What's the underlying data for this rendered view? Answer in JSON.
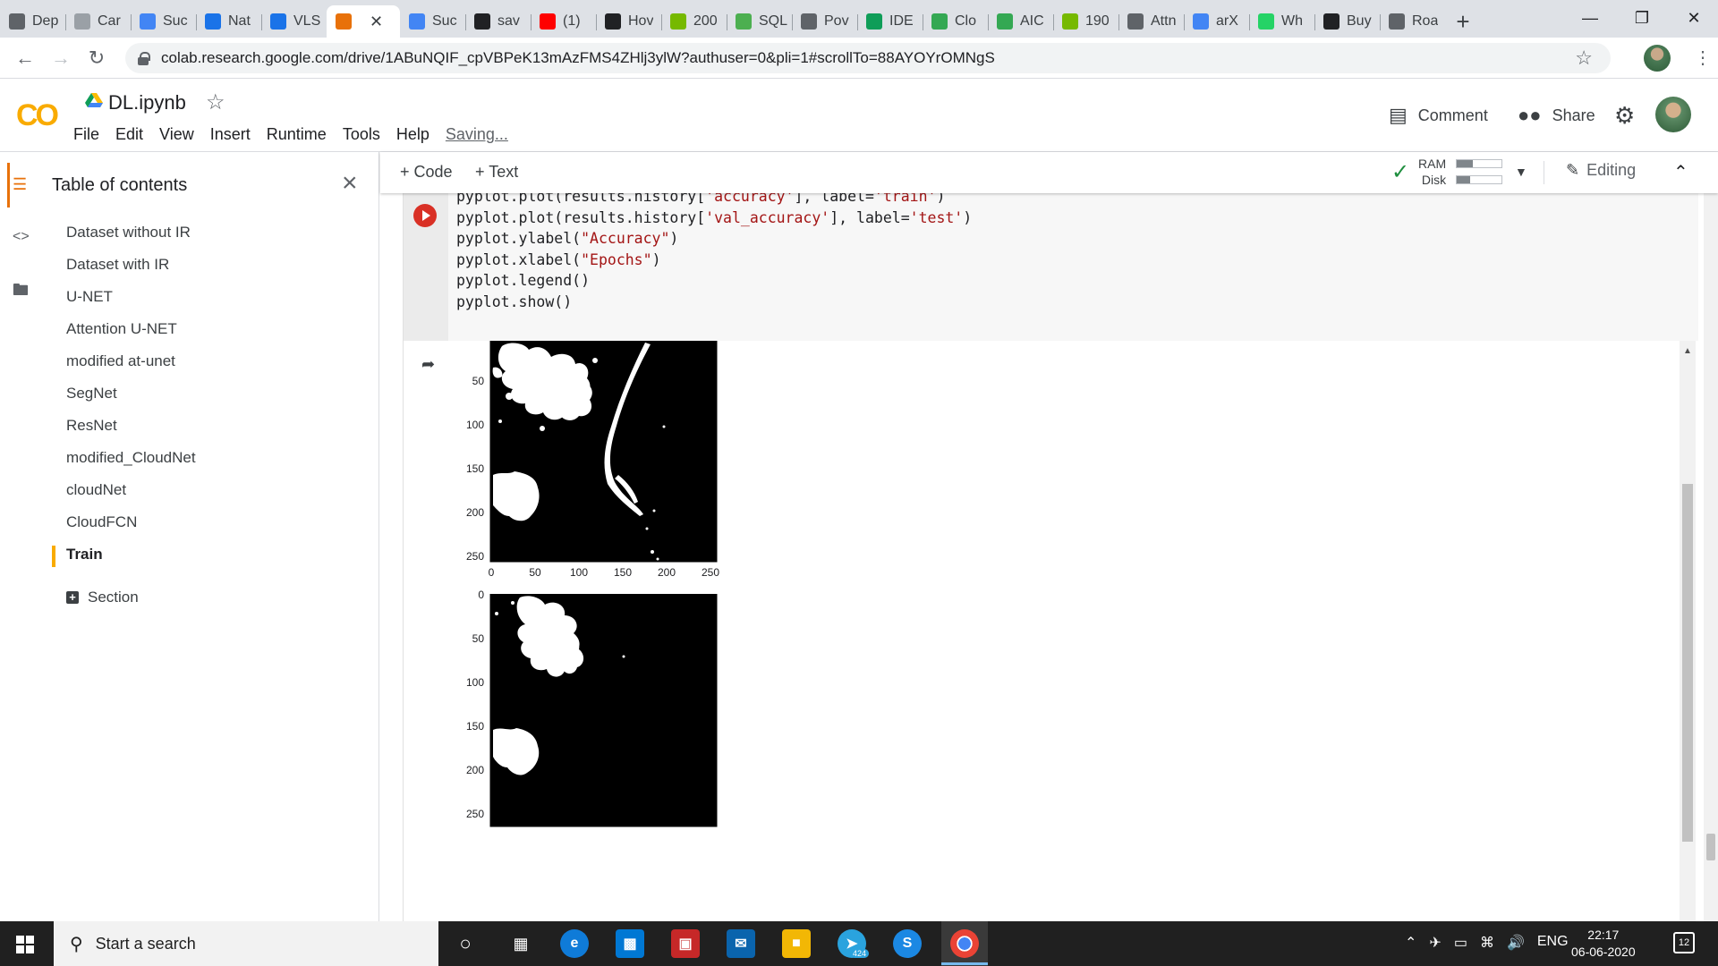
{
  "browser": {
    "tabs": [
      {
        "title": "Dep",
        "icon": "leaf-icon",
        "color": "#5f6368"
      },
      {
        "title": "Car",
        "icon": "page-icon",
        "color": "#9aa0a6"
      },
      {
        "title": "Suc",
        "icon": "google-icon",
        "color": "#4285f4"
      },
      {
        "title": "Nat",
        "icon": "colab-icon",
        "color": "#1a73e8"
      },
      {
        "title": "VLS",
        "icon": "colab-icon",
        "color": "#1a73e8"
      },
      {
        "title": "",
        "icon": "colab-icon",
        "color": "#e8710a",
        "active": true
      },
      {
        "title": "Suc",
        "icon": "google-icon",
        "color": "#4285f4"
      },
      {
        "title": "sav",
        "icon": "github-icon",
        "color": "#202124"
      },
      {
        "title": "(1)",
        "icon": "youtube-icon",
        "color": "#ff0000"
      },
      {
        "title": "Hov",
        "icon": "le-icon",
        "color": "#202124"
      },
      {
        "title": "200",
        "icon": "smiley-icon",
        "color": "#76b900"
      },
      {
        "title": "SQL",
        "icon": "w3-icon",
        "color": "#4caf50"
      },
      {
        "title": "Pov",
        "icon": "globe-icon",
        "color": "#5f6368"
      },
      {
        "title": "IDE",
        "icon": "gg-icon",
        "color": "#0f9d58"
      },
      {
        "title": "Clo",
        "icon": "swirl-icon",
        "color": "#34a853"
      },
      {
        "title": "AIC",
        "icon": "swirl-icon",
        "color": "#34a853"
      },
      {
        "title": "190",
        "icon": "smiley-icon",
        "color": "#76b900"
      },
      {
        "title": "Attn",
        "icon": "hand-icon",
        "color": "#5f6368"
      },
      {
        "title": "arX",
        "icon": "google-icon",
        "color": "#4285f4"
      },
      {
        "title": "Wh",
        "icon": "whatsapp-icon",
        "color": "#25d366"
      },
      {
        "title": "Buy",
        "icon": "amazon-icon",
        "color": "#202124"
      },
      {
        "title": "Roa",
        "icon": "globe-icon",
        "color": "#5f6368"
      }
    ],
    "new_tab": "+",
    "url": "colab.research.google.com/drive/1ABuNQIF_cpVBPeK13mAzFMS4ZHlj3ylW?authuser=0&pli=1#scrollTo=88AYOYrOMNgS"
  },
  "colab": {
    "logo": "CO",
    "title": "DL.ipynb",
    "menu": [
      "File",
      "Edit",
      "View",
      "Insert",
      "Runtime",
      "Tools",
      "Help"
    ],
    "status": "Saving...",
    "comment": "Comment",
    "share": "Share"
  },
  "toc": {
    "title": "Table of contents",
    "items": [
      {
        "label": "Dataset without IR"
      },
      {
        "label": "Dataset with IR"
      },
      {
        "label": "U-NET"
      },
      {
        "label": "Attention U-NET"
      },
      {
        "label": "modified at-unet"
      },
      {
        "label": "SegNet"
      },
      {
        "label": "ResNet"
      },
      {
        "label": "modified_CloudNet"
      },
      {
        "label": "cloudNet"
      },
      {
        "label": "CloudFCN"
      },
      {
        "label": "Train",
        "active": true
      }
    ],
    "section": "Section"
  },
  "nb_toolbar": {
    "code": "+ Code",
    "text": "+ Text",
    "ram": "RAM",
    "disk": "Disk",
    "ram_fill": 0.35,
    "disk_fill": 0.3,
    "editing": "Editing"
  },
  "code": {
    "line0": {
      "a": "pyplot.plot(results.history[",
      "s1": "'accuracy'",
      "b": "], label=",
      "s2": "'train'",
      "c": ")"
    },
    "line1": {
      "a": "pyplot.plot(results.history[",
      "s1": "'val_accuracy'",
      "b": "], label=",
      "s2": "'test'",
      "c": ")"
    },
    "line2": {
      "a": "pyplot.ylabel(",
      "s1": "\"Accuracy\"",
      "c": ")"
    },
    "line3": {
      "a": "pyplot.xlabel(",
      "s1": "\"Epochs\"",
      "c": ")"
    },
    "line4": "pyplot.legend()",
    "line5": "pyplot.show()"
  },
  "plots": {
    "plot1": {
      "yticks": [
        "50",
        "100",
        "150",
        "200",
        "250"
      ],
      "xticks": [
        "0",
        "50",
        "100",
        "150",
        "200",
        "250"
      ]
    },
    "plot2": {
      "yticks": [
        "0",
        "50",
        "100",
        "150",
        "200",
        "250"
      ]
    }
  },
  "taskbar": {
    "search_placeholder": "Start a search",
    "telegram_badge": "424",
    "lang": "ENG",
    "time": "22:17",
    "date": "06-06-2020",
    "notifications": "12"
  }
}
